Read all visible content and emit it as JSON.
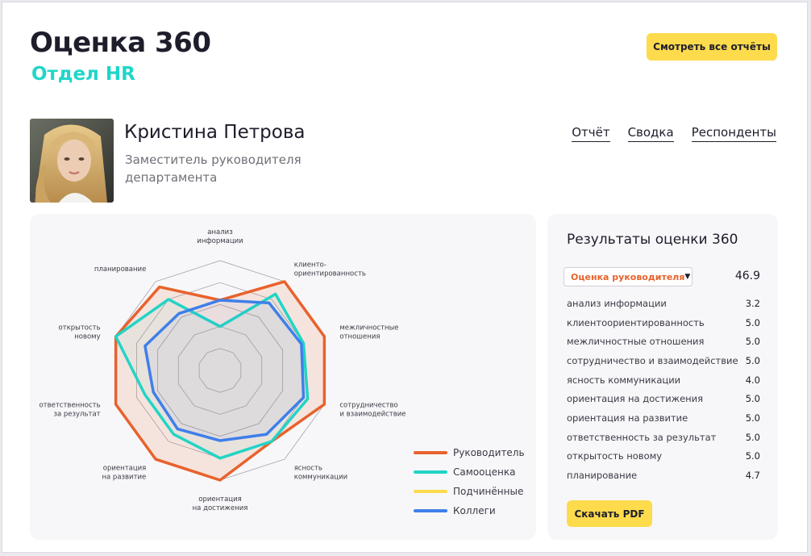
{
  "header": {
    "title": "Оценка 360",
    "subtitle": "Отдел HR",
    "all_reports_label": "Смотреть все отчёты"
  },
  "profile": {
    "name": "Кристина Петрова",
    "role": "Заместитель руководителя департамента"
  },
  "nav": {
    "items": [
      "Отчёт",
      "Сводка",
      "Респонденты"
    ]
  },
  "results": {
    "title": "Результаты оценки 360",
    "selected_option": "Оценка руководителя",
    "total": "46.9",
    "scores": [
      {
        "label": "анализ информации",
        "value": "3.2"
      },
      {
        "label": "клиентоориентированность",
        "value": "5.0"
      },
      {
        "label": "межличностные отношения",
        "value": "5.0"
      },
      {
        "label": "сотрудничество и взаимодействие",
        "value": "5.0"
      },
      {
        "label": "ясность коммуникации",
        "value": "4.0"
      },
      {
        "label": "ориентация на достижения",
        "value": "5.0"
      },
      {
        "label": "ориентация на развитие",
        "value": "5.0"
      },
      {
        "label": "ответственность за результат",
        "value": "5.0"
      },
      {
        "label": "открытость новому",
        "value": "5.0"
      },
      {
        "label": "планирование",
        "value": "4.7"
      }
    ],
    "download_label": "Скачать PDF"
  },
  "colors": {
    "accent_yellow": "#fddb4c",
    "accent_teal": "#1fd6c9",
    "manager": "#e8622d",
    "self": "#22d4c5",
    "subordinates": "#fddb4c",
    "colleagues": "#3f7fea"
  },
  "chart_data": {
    "type": "radar",
    "axes": [
      [
        "анализ",
        "информации"
      ],
      [
        "клиенто-",
        "ориентированность"
      ],
      [
        "межличностные",
        "отношения"
      ],
      [
        "сотрудничество",
        "и взаимодействие"
      ],
      [
        "ясность",
        "коммуникации"
      ],
      [
        "ориентация",
        "на достижения"
      ],
      [
        "ориентация",
        "на развитие"
      ],
      [
        "ответственность",
        "за результат"
      ],
      [
        "открытость",
        "новому"
      ],
      [
        "планирование"
      ]
    ],
    "range": [
      0,
      5
    ],
    "grid_levels": 5,
    "series": [
      {
        "name": "Руководитель",
        "color": "#e8622d",
        "filled": true,
        "values": [
          3.2,
          5.0,
          5.0,
          5.0,
          4.0,
          5.0,
          5.0,
          5.0,
          5.0,
          4.7
        ]
      },
      {
        "name": "Самооценка",
        "color": "#22d4c5",
        "filled": false,
        "values": [
          2.0,
          4.3,
          4.0,
          4.2,
          4.0,
          4.0,
          3.6,
          3.6,
          5.0,
          4.0
        ]
      },
      {
        "name": "Подчинённые",
        "color": "#fddb4c",
        "filled": false,
        "values": []
      },
      {
        "name": "Коллеги",
        "color": "#3f7fea",
        "filled": false,
        "values": [
          3.2,
          3.8,
          3.9,
          4.0,
          3.6,
          3.2,
          3.3,
          3.2,
          3.6,
          3.2
        ]
      }
    ],
    "legend": "bottom-right"
  }
}
